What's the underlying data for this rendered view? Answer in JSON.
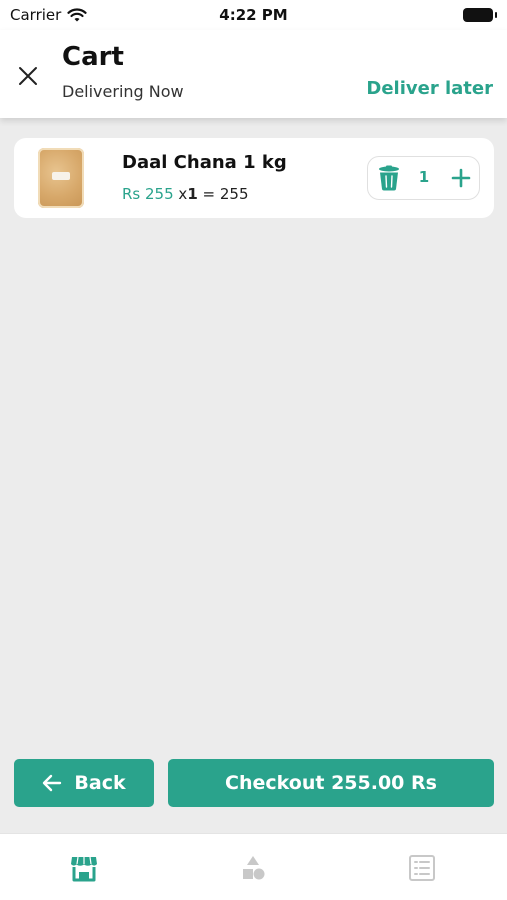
{
  "status_bar": {
    "carrier": "Carrier",
    "time": "4:22 PM"
  },
  "header": {
    "title": "Cart",
    "subtitle": "Delivering Now",
    "deliver_later": "Deliver later"
  },
  "cart": {
    "items": [
      {
        "name": "Daal Chana 1 kg",
        "unit_price": "Rs 255",
        "times": "x",
        "quantity": "1",
        "equals": "=",
        "total": "255",
        "icon": "lentil-bag-image"
      }
    ]
  },
  "footer": {
    "back_label": "Back",
    "checkout_label": "Checkout 255.00 Rs"
  },
  "tabs": [
    {
      "name": "store",
      "icon": "storefront-icon",
      "active": true
    },
    {
      "name": "categories",
      "icon": "shapes-icon",
      "active": false
    },
    {
      "name": "orders",
      "icon": "list-icon",
      "active": false
    }
  ],
  "colors": {
    "accent": "#2aa38c",
    "background": "#ececec",
    "card": "#ffffff",
    "inactive_icon": "#c8c8c8"
  }
}
